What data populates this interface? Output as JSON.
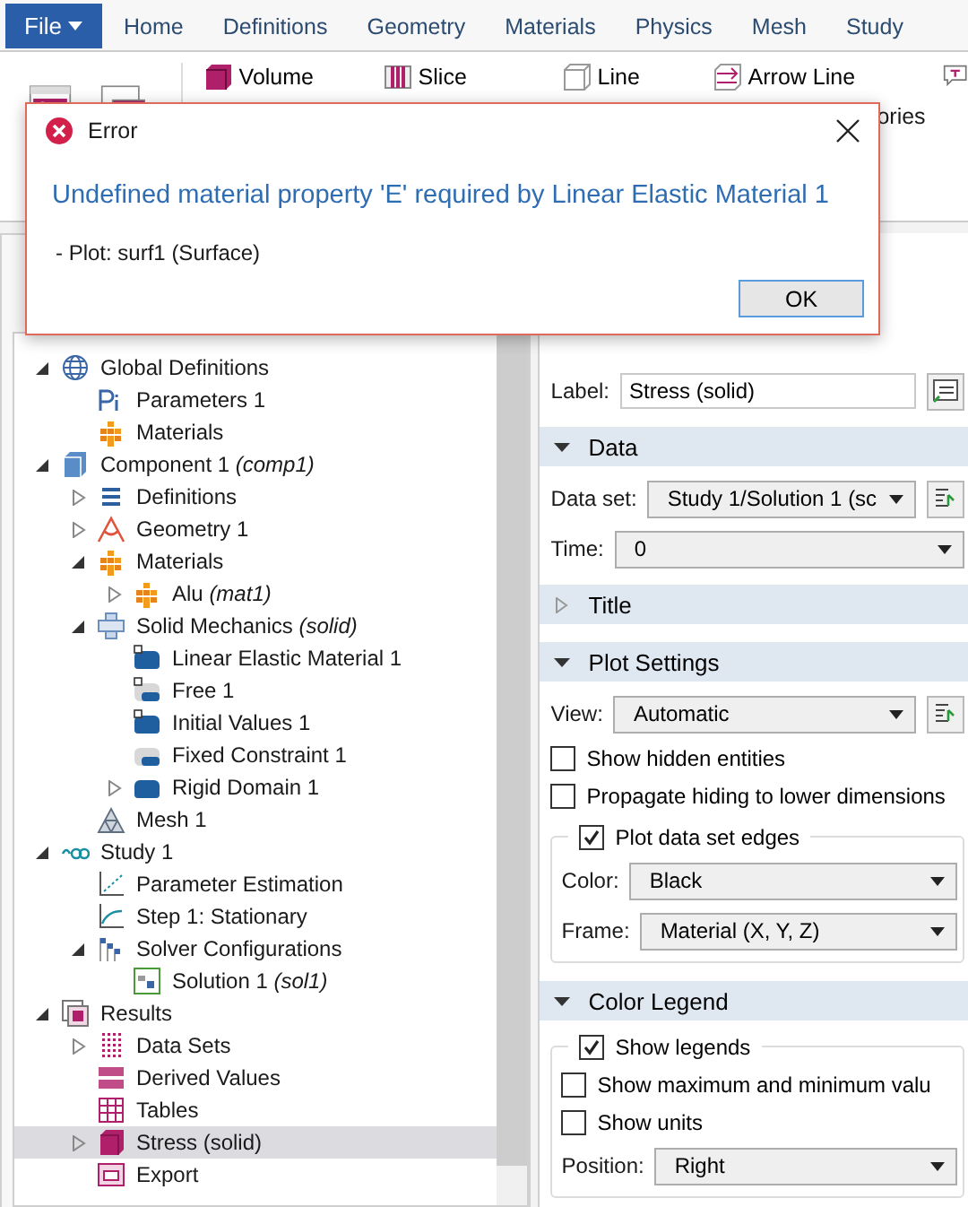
{
  "file_button": {
    "label": "File"
  },
  "tabs": [
    {
      "label": "Home"
    },
    {
      "label": "Definitions"
    },
    {
      "label": "Geometry"
    },
    {
      "label": "Materials"
    },
    {
      "label": "Physics"
    },
    {
      "label": "Mesh"
    },
    {
      "label": "Study"
    }
  ],
  "ribbon": {
    "items": [
      {
        "label": "Volume",
        "kind": "volume"
      },
      {
        "label": "Slice",
        "kind": "slice"
      },
      {
        "label": "Line",
        "kind": "line"
      },
      {
        "label": "Arrow Line",
        "kind": "arrow"
      }
    ],
    "partial_label": "ories"
  },
  "dialog": {
    "title": "Error",
    "message": "Undefined material property 'E' required by Linear Elastic Material 1",
    "detail": "- Plot: surf1 (Surface)",
    "button": "OK"
  },
  "tree": [
    {
      "label": "Global Definitions",
      "kind": "globe",
      "expanded": true,
      "selected": false,
      "children": [
        {
          "label": "Parameters 1",
          "kind": "params",
          "selected": false
        },
        {
          "label": "Materials",
          "kind": "materials",
          "selected": false
        }
      ]
    },
    {
      "label": "Component 1 *(comp1)*",
      "kind": "component",
      "expanded": true,
      "selected": false,
      "children": [
        {
          "label": "Definitions",
          "kind": "list",
          "expanded": false,
          "selected": false
        },
        {
          "label": "Geometry 1",
          "kind": "geometry",
          "expanded": false,
          "selected": false
        },
        {
          "label": "Materials",
          "kind": "materials",
          "expanded": true,
          "selected": false,
          "children": [
            {
              "label": "Alu *(mat1)*",
              "kind": "materials",
              "expanded": false,
              "selected": false
            }
          ]
        },
        {
          "label": "Solid Mechanics *(solid)*",
          "kind": "physics",
          "expanded": true,
          "selected": false,
          "children": [
            {
              "label": "Linear Elastic Material 1",
              "kind": "feature-d",
              "selected": false
            },
            {
              "label": "Free 1",
              "kind": "feature-d-light",
              "selected": false
            },
            {
              "label": "Initial Values 1",
              "kind": "feature-d",
              "selected": false
            },
            {
              "label": "Fixed Constraint 1",
              "kind": "feature-light",
              "selected": false
            },
            {
              "label": "Rigid Domain 1",
              "kind": "feature",
              "expanded": false,
              "selected": false
            }
          ]
        },
        {
          "label": "Mesh 1",
          "kind": "mesh",
          "selected": false
        }
      ]
    },
    {
      "label": "Study 1",
      "kind": "study",
      "expanded": true,
      "selected": false,
      "children": [
        {
          "label": "Parameter Estimation",
          "kind": "param-est",
          "selected": false
        },
        {
          "label": "Step 1: Stationary",
          "kind": "step",
          "selected": false
        },
        {
          "label": "Solver Configurations",
          "kind": "solver",
          "expanded": true,
          "selected": false,
          "children": [
            {
              "label": "Solution 1 *(sol1)*",
              "kind": "solution",
              "selected": false
            }
          ]
        }
      ]
    },
    {
      "label": "Results",
      "kind": "results",
      "expanded": true,
      "selected": false,
      "children": [
        {
          "label": "Data Sets",
          "kind": "datasets",
          "expanded": false,
          "selected": false
        },
        {
          "label": "Derived Values",
          "kind": "derived",
          "selected": false
        },
        {
          "label": "Tables",
          "kind": "tables",
          "selected": false
        },
        {
          "label": "Stress (solid)",
          "kind": "plot",
          "expanded": false,
          "selected": true
        },
        {
          "label": "Export",
          "kind": "export",
          "selected": false
        }
      ]
    }
  ],
  "settings": {
    "label_field": {
      "label": "Label:",
      "value": "Stress (solid)"
    },
    "sections": [
      {
        "title": "Data",
        "expanded": true,
        "rows": [
          {
            "kind": "select",
            "label": "Data set:",
            "value": "Study 1/Solution 1 (sc",
            "side_button": true
          },
          {
            "kind": "select",
            "label": "Time:",
            "value": "0",
            "side_button": false
          }
        ]
      },
      {
        "title": "Title",
        "expanded": false
      },
      {
        "title": "Plot Settings",
        "expanded": true,
        "rows": [
          {
            "kind": "select",
            "label": "View:",
            "value": "Automatic",
            "side_button": true
          },
          {
            "kind": "checkbox",
            "label": "Show hidden entities",
            "checked": false
          },
          {
            "kind": "checkbox",
            "label": "Propagate hiding to lower dimensions",
            "checked": false
          },
          {
            "kind": "group",
            "label": "Plot data set edges",
            "checked": true,
            "rows": [
              {
                "kind": "select",
                "label": "Color:",
                "value": "Black",
                "side_button": false
              },
              {
                "kind": "select",
                "label": "Frame:",
                "value": "Material  (X, Y, Z)",
                "side_button": false
              }
            ]
          }
        ]
      },
      {
        "title": "Color Legend",
        "expanded": true,
        "rows": [
          {
            "kind": "group",
            "label": "Show legends",
            "checked": true,
            "rows": [
              {
                "kind": "checkbox",
                "label": "Show maximum and minimum valu",
                "checked": false
              },
              {
                "kind": "checkbox",
                "label": "Show units",
                "checked": false
              },
              {
                "kind": "select",
                "label": "Position:",
                "value": "Right",
                "side_button": false
              }
            ]
          }
        ]
      }
    ]
  }
}
